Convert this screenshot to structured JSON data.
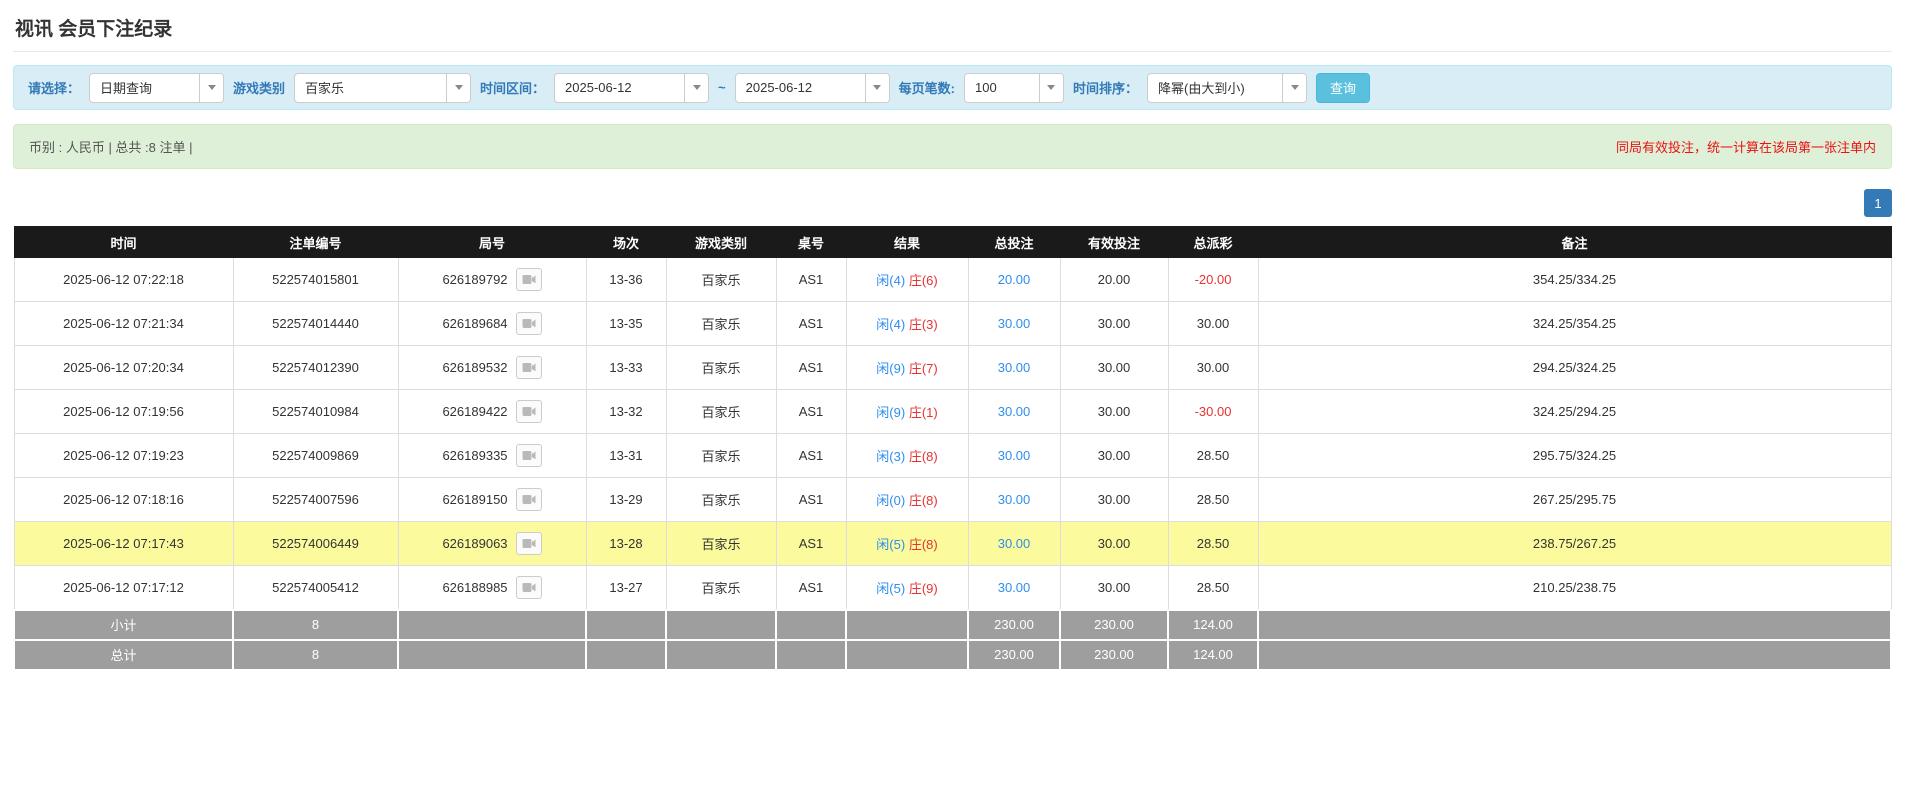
{
  "page": {
    "title": "视讯 会员下注纪录"
  },
  "filters": {
    "select_label": "请选择：",
    "select_value": "日期查询",
    "game_type_label": "游戏类别",
    "game_type_value": "百家乐",
    "date_range_label": "时间区间：",
    "date_from": "2025-06-12",
    "date_separator": "~",
    "date_to": "2025-06-12",
    "page_size_label": "每页笔数:",
    "page_size_value": "100",
    "sort_label": "时间排序：",
    "sort_value": "降幂(由大到小)",
    "search_button": "查询"
  },
  "summary": {
    "left_text": "币别 : 人民币 | 总共 :8 注单 |",
    "right_notice": "同局有效投注，统一计算在该局第一张注单内"
  },
  "pagination": {
    "page_1": "1"
  },
  "table": {
    "headers": [
      "时间",
      "注单编号",
      "局号",
      "场次",
      "游戏类别",
      "桌号",
      "结果",
      "总投注",
      "有效投注",
      "总派彩",
      "备注"
    ],
    "rows": [
      {
        "time": "2025-06-12 07:22:18",
        "bet_id": "522574015801",
        "round_id": "626189792",
        "session": "13-36",
        "game": "百家乐",
        "table_no": "AS1",
        "result_player": "闲(4)",
        "result_banker": "庄(6)",
        "total_bet": "20.00",
        "valid_bet": "20.00",
        "payout": "-20.00",
        "remark": "354.25/334.25",
        "highlight": false
      },
      {
        "time": "2025-06-12 07:21:34",
        "bet_id": "522574014440",
        "round_id": "626189684",
        "session": "13-35",
        "game": "百家乐",
        "table_no": "AS1",
        "result_player": "闲(4)",
        "result_banker": "庄(3)",
        "total_bet": "30.00",
        "valid_bet": "30.00",
        "payout": "30.00",
        "remark": "324.25/354.25",
        "highlight": false
      },
      {
        "time": "2025-06-12 07:20:34",
        "bet_id": "522574012390",
        "round_id": "626189532",
        "session": "13-33",
        "game": "百家乐",
        "table_no": "AS1",
        "result_player": "闲(9)",
        "result_banker": "庄(7)",
        "total_bet": "30.00",
        "valid_bet": "30.00",
        "payout": "30.00",
        "remark": "294.25/324.25",
        "highlight": false
      },
      {
        "time": "2025-06-12 07:19:56",
        "bet_id": "522574010984",
        "round_id": "626189422",
        "session": "13-32",
        "game": "百家乐",
        "table_no": "AS1",
        "result_player": "闲(9)",
        "result_banker": "庄(1)",
        "total_bet": "30.00",
        "valid_bet": "30.00",
        "payout": "-30.00",
        "remark": "324.25/294.25",
        "highlight": false
      },
      {
        "time": "2025-06-12 07:19:23",
        "bet_id": "522574009869",
        "round_id": "626189335",
        "session": "13-31",
        "game": "百家乐",
        "table_no": "AS1",
        "result_player": "闲(3)",
        "result_banker": "庄(8)",
        "total_bet": "30.00",
        "valid_bet": "30.00",
        "payout": "28.50",
        "remark": "295.75/324.25",
        "highlight": false
      },
      {
        "time": "2025-06-12 07:18:16",
        "bet_id": "522574007596",
        "round_id": "626189150",
        "session": "13-29",
        "game": "百家乐",
        "table_no": "AS1",
        "result_player": "闲(0)",
        "result_banker": "庄(8)",
        "total_bet": "30.00",
        "valid_bet": "30.00",
        "payout": "28.50",
        "remark": "267.25/295.75",
        "highlight": false
      },
      {
        "time": "2025-06-12 07:17:43",
        "bet_id": "522574006449",
        "round_id": "626189063",
        "session": "13-28",
        "game": "百家乐",
        "table_no": "AS1",
        "result_player": "闲(5)",
        "result_banker": "庄(8)",
        "total_bet": "30.00",
        "valid_bet": "30.00",
        "payout": "28.50",
        "remark": "238.75/267.25",
        "highlight": true
      },
      {
        "time": "2025-06-12 07:17:12",
        "bet_id": "522574005412",
        "round_id": "626188985",
        "session": "13-27",
        "game": "百家乐",
        "table_no": "AS1",
        "result_player": "闲(5)",
        "result_banker": "庄(9)",
        "total_bet": "30.00",
        "valid_bet": "30.00",
        "payout": "28.50",
        "remark": "210.25/238.75",
        "highlight": false
      }
    ],
    "subtotal": {
      "label": "小计",
      "count": "8",
      "total_bet": "230.00",
      "valid_bet": "230.00",
      "payout": "124.00"
    },
    "total": {
      "label": "总计",
      "count": "8",
      "total_bet": "230.00",
      "valid_bet": "230.00",
      "payout": "124.00"
    }
  }
}
